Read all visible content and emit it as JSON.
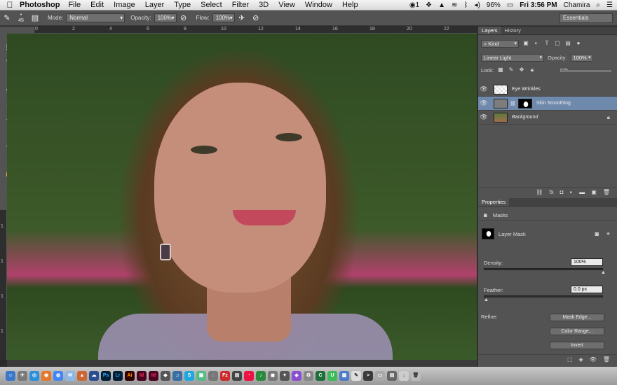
{
  "menubar": {
    "app": "Photoshop",
    "items": [
      "File",
      "Edit",
      "Image",
      "Layer",
      "Type",
      "Select",
      "Filter",
      "3D",
      "View",
      "Window",
      "Help"
    ],
    "clock": "Fri 3:56 PM",
    "user": "Chamira",
    "battery": "96%",
    "status_count": "1"
  },
  "options_bar": {
    "brush_size": "45",
    "mode_label": "Mode:",
    "mode_value": "Normal",
    "opacity_label": "Opacity:",
    "opacity_value": "100%",
    "flow_label": "Flow:",
    "flow_value": "100%",
    "workspace": "Essentials"
  },
  "ruler": {
    "top": [
      "0",
      "2",
      "4",
      "6",
      "8",
      "10",
      "12",
      "14",
      "16",
      "18",
      "20",
      "22"
    ],
    "left": [
      "1",
      "1",
      "1",
      "1"
    ]
  },
  "layers_panel": {
    "tabs": [
      "Layers",
      "History"
    ],
    "filter_kind": "Kind",
    "blend_mode": "Linear Light",
    "opacity_label": "Opacity:",
    "opacity_value": "100%",
    "lock_label": "Lock:",
    "fill_label": "Fill:",
    "layers": [
      {
        "name": "Eye Wrinkles",
        "selected": false
      },
      {
        "name": "Skin Smoothing",
        "selected": true
      },
      {
        "name": "Background",
        "selected": false
      }
    ]
  },
  "properties_panel": {
    "title": "Properties",
    "section": "Masks",
    "mask_type": "Layer Mask",
    "density_label": "Density:",
    "density_value": "100%",
    "density_level": 1.0,
    "feather_label": "Feather:",
    "feather_value": "0.0 px",
    "feather_level": 0.0,
    "refine_label": "Refine:",
    "buttons": [
      "Mask Edge...",
      "Color Range...",
      "Invert"
    ]
  },
  "colors": {
    "ui_panel": "#535353",
    "selected_layer": "#6f89ad"
  }
}
